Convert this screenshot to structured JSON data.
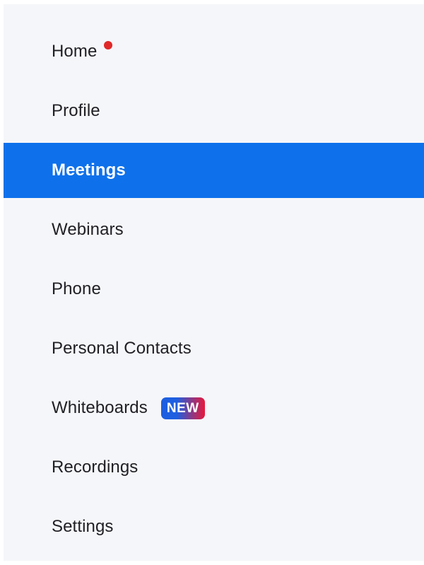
{
  "colors": {
    "sidebar_bg": "#f5f6f9",
    "active_bg": "#0e71eb",
    "text": "#1f1f24",
    "active_text": "#ffffff",
    "notification_dot": "#e02828",
    "badge_gradient_start": "#1d5fe0",
    "badge_gradient_end": "#e8183a"
  },
  "sidebar": {
    "active_item": "Meetings",
    "items": [
      {
        "label": "Home",
        "indicator": "notification-dot"
      },
      {
        "label": "Profile"
      },
      {
        "label": "Meetings",
        "active": true
      },
      {
        "label": "Webinars"
      },
      {
        "label": "Phone"
      },
      {
        "label": "Personal Contacts"
      },
      {
        "label": "Whiteboards",
        "badge": "NEW"
      },
      {
        "label": "Recordings"
      },
      {
        "label": "Settings"
      }
    ]
  }
}
